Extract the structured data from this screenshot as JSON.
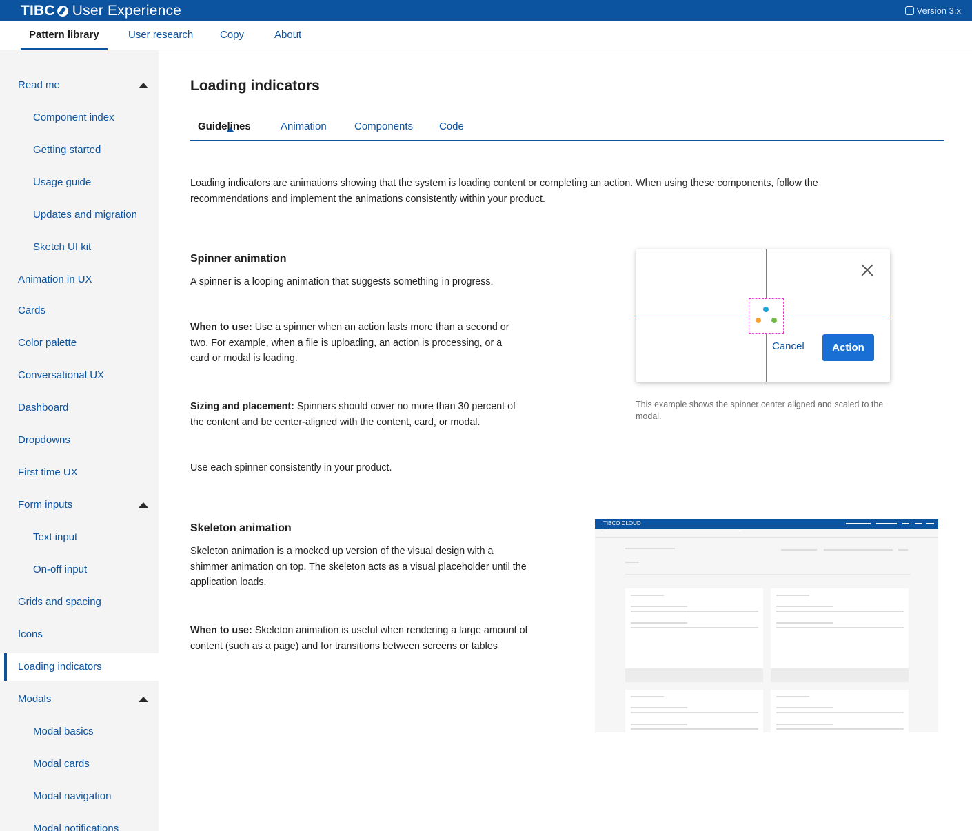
{
  "header": {
    "brand_strong": "TIBC",
    "brand_rest": "User Experience",
    "version": "Version 3.x"
  },
  "topnav": {
    "items": [
      {
        "label": "Pattern library",
        "active": true
      },
      {
        "label": "User research",
        "active": false
      },
      {
        "label": "Copy",
        "active": false
      },
      {
        "label": "About",
        "active": false
      }
    ]
  },
  "sidebar": {
    "items": [
      {
        "label": "Read me",
        "level": 0,
        "expanded": true
      },
      {
        "label": "Component index",
        "level": 1
      },
      {
        "label": "Getting started",
        "level": 1
      },
      {
        "label": "Usage guide",
        "level": 1
      },
      {
        "label": "Updates and migration",
        "level": 1
      },
      {
        "label": "Sketch UI kit",
        "level": 1
      },
      {
        "label": "Animation in UX",
        "level": 0
      },
      {
        "label": "Cards",
        "level": 0
      },
      {
        "label": "Color palette",
        "level": 0
      },
      {
        "label": "Conversational UX",
        "level": 0
      },
      {
        "label": "Dashboard",
        "level": 0
      },
      {
        "label": "Dropdowns",
        "level": 0
      },
      {
        "label": "First time UX",
        "level": 0
      },
      {
        "label": "Form inputs",
        "level": 0,
        "expanded": true
      },
      {
        "label": "Text input",
        "level": 1
      },
      {
        "label": "On-off input",
        "level": 1
      },
      {
        "label": "Grids and spacing",
        "level": 0
      },
      {
        "label": "Icons",
        "level": 0
      },
      {
        "label": "Loading indicators",
        "level": 0,
        "active": true
      },
      {
        "label": "Modals",
        "level": 0,
        "expanded": true
      },
      {
        "label": "Modal basics",
        "level": 1
      },
      {
        "label": "Modal cards",
        "level": 1
      },
      {
        "label": "Modal navigation",
        "level": 1
      },
      {
        "label": "Modal notifications",
        "level": 1
      }
    ]
  },
  "main": {
    "title": "Loading indicators",
    "tabs": [
      {
        "label": "Guidelines",
        "active": true
      },
      {
        "label": "Animation",
        "active": false
      },
      {
        "label": "Components",
        "active": false
      },
      {
        "label": "Code",
        "active": false
      }
    ],
    "intro": "Loading indicators are animations showing that the system is loading content or completing an action. When using these components, follow the recommendations and implement the animations consistently within your product.",
    "spinner": {
      "heading": "Spinner animation",
      "desc": "A spinner is a looping animation that suggests something in progress.",
      "when_label": "When to use:",
      "when_text": " Use a spinner when an action lasts more than a second or two. For example, when a file is uploading, an action is processing, or a card or modal is loading.",
      "sizing_label": "Sizing and placement:",
      "sizing_text": " Spinners should cover no more than 30 percent of the content and be center-aligned with the content, card, or modal.",
      "consistency": "Use each spinner consistently in your product.",
      "example": {
        "cancel_label": "Cancel",
        "action_label": "Action",
        "dot_colors": [
          "#1fa3d6",
          "#f7a23b",
          "#72b84a"
        ],
        "guide_color": "#e23cc7"
      },
      "caption": "This example shows the spinner center aligned and scaled to the modal."
    },
    "skeleton": {
      "heading": "Skeleton animation",
      "desc": "Skeleton animation is a mocked up version of the visual design with a shimmer animation on top. The skeleton acts as a visual placeholder until the application loads.",
      "when_label": "When to use:",
      "when_text": " Skeleton animation is useful when rendering a large amount of content (such as a page) and for transitions between screens or tables",
      "example": {
        "app_name": "TIBCO CLOUD"
      }
    }
  },
  "colors": {
    "brand_blue": "#0d54a0",
    "action_blue": "#1a6fd4",
    "sidebar_bg": "#f4f4f4"
  }
}
